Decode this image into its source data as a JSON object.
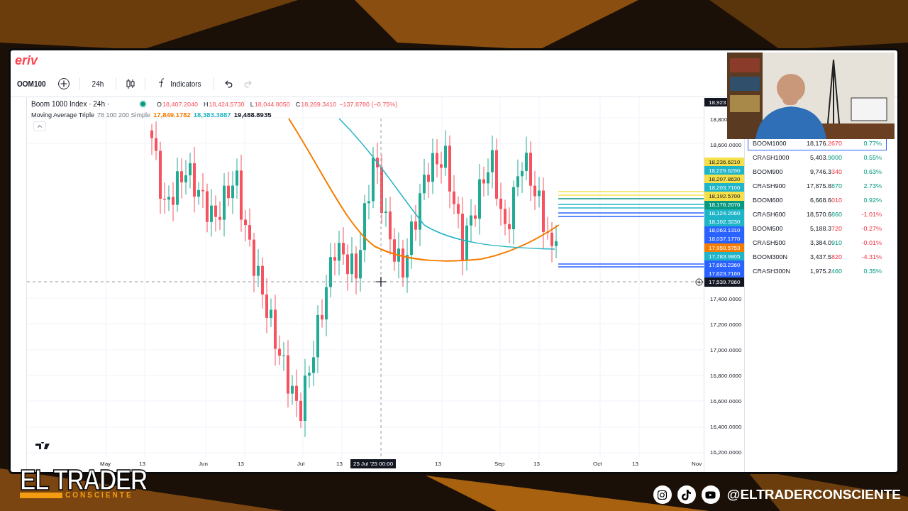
{
  "brand": {
    "logo": "eriv"
  },
  "toolbar": {
    "symbol": "OOM100",
    "interval": "24h",
    "indicators": "Indicators"
  },
  "legend": {
    "title": "Boom 1000 Index · 24h ·",
    "market_open": true,
    "ohlc": [
      {
        "label": "O",
        "value": "18,407.2040"
      },
      {
        "label": "H",
        "value": "18,424.5730"
      },
      {
        "label": "L",
        "value": "18,044.8050"
      },
      {
        "label": "C",
        "value": "18,269.3410"
      }
    ],
    "change": "−137.8780 (−0.75%)",
    "ma_name": "Moving Average Triple",
    "ma_params": "78 100 200 Simple",
    "ma_values": [
      {
        "value": "17,849.1782",
        "color": "#f57c00"
      },
      {
        "value": "18,383.3887",
        "color": "#26b5c6"
      },
      {
        "value": "19,488.8935",
        "color": "#131722"
      }
    ]
  },
  "price_axis": [
    {
      "kind": "tag",
      "text": "18,923",
      "color": "#131722"
    },
    {
      "kind": "tick",
      "text": "18,800"
    },
    {
      "kind": "tick",
      "text": "18,600.0000"
    },
    {
      "kind": "tag",
      "text": "18,236.6210",
      "color": "#f5e04a"
    },
    {
      "kind": "tag",
      "text": "18,229.6290",
      "color": "#1fb5c9"
    },
    {
      "kind": "tag",
      "text": "18,207.8630",
      "color": "#f5e04a"
    },
    {
      "kind": "tag",
      "text": "18,203.7100",
      "color": "#1fb5c9"
    },
    {
      "kind": "tag",
      "text": "18,192.5700",
      "color": "#f5e04a"
    },
    {
      "kind": "tag",
      "text": "18,176.2070",
      "color": "#089981"
    },
    {
      "kind": "tag",
      "text": "18,124.2060",
      "color": "#1fb5c9"
    },
    {
      "kind": "tag",
      "text": "18,102.3230",
      "color": "#1fb5c9"
    },
    {
      "kind": "tag",
      "text": "18,063.1310",
      "color": "#2962ff"
    },
    {
      "kind": "tag",
      "text": "18,037.1770",
      "color": "#2962ff"
    },
    {
      "kind": "tag",
      "text": "17,950.5753",
      "color": "#f57c00"
    },
    {
      "kind": "tag",
      "text": "17,783.9805",
      "color": "#1fb5c9"
    },
    {
      "kind": "tag",
      "text": "17,663.2360",
      "color": "#2962ff"
    },
    {
      "kind": "tag",
      "text": "17,623.7160",
      "color": "#2962ff"
    },
    {
      "kind": "tag",
      "text": "17,539.7860",
      "color": "#131722"
    },
    {
      "kind": "tick",
      "text": "17,400.0000"
    },
    {
      "kind": "tick",
      "text": "17,200.0000"
    },
    {
      "kind": "tick",
      "text": "17,000.0000"
    },
    {
      "kind": "tick",
      "text": "16,800.0000"
    },
    {
      "kind": "tick",
      "text": "16,600.0000"
    },
    {
      "kind": "tick",
      "text": "16,400.0000"
    },
    {
      "kind": "tick",
      "text": "16,200.0000"
    }
  ],
  "time_axis": [
    {
      "kind": "month",
      "text": "May"
    },
    {
      "kind": "day",
      "text": "13"
    },
    {
      "kind": "month",
      "text": "Jun"
    },
    {
      "kind": "day",
      "text": "13"
    },
    {
      "kind": "month",
      "text": "Jul"
    },
    {
      "kind": "day",
      "text": "13"
    },
    {
      "kind": "crosshair",
      "text": "25 Jul '25   00:00"
    },
    {
      "kind": "day",
      "text": "13"
    },
    {
      "kind": "month",
      "text": "Sep"
    },
    {
      "kind": "day",
      "text": "13"
    },
    {
      "kind": "month",
      "text": "Oct"
    },
    {
      "kind": "day",
      "text": "13"
    },
    {
      "kind": "month",
      "text": "Nov"
    }
  ],
  "watchlist": [
    {
      "symbol": "BOOM1000",
      "price": "18,176.",
      "price_tail": "2670",
      "tick_up": false,
      "change": "0.77%",
      "change_up": true,
      "selected": true
    },
    {
      "symbol": "CRASH1000",
      "price": "5,403.",
      "price_tail": "9000",
      "tick_up": true,
      "change": "0.55%",
      "change_up": true,
      "selected": false
    },
    {
      "symbol": "BOOM900",
      "price": "9,746.3",
      "price_tail": "340",
      "tick_up": false,
      "change": "0.63%",
      "change_up": true,
      "selected": false
    },
    {
      "symbol": "CRASH900",
      "price": "17,875.8",
      "price_tail": "870",
      "tick_up": true,
      "change": "2.73%",
      "change_up": true,
      "selected": false
    },
    {
      "symbol": "BOOM600",
      "price": "6,668.6",
      "price_tail": "010",
      "tick_up": false,
      "change": "0.92%",
      "change_up": true,
      "selected": false
    },
    {
      "symbol": "CRASH600",
      "price": "18,570.6",
      "price_tail": "860",
      "tick_up": true,
      "change": "-1.01%",
      "change_up": false,
      "selected": false
    },
    {
      "symbol": "BOOM500",
      "price": "5,188.3",
      "price_tail": "720",
      "tick_up": false,
      "change": "-0.27%",
      "change_up": false,
      "selected": false
    },
    {
      "symbol": "CRASH500",
      "price": "3,384.0",
      "price_tail": "910",
      "tick_up": true,
      "change": "-0.01%",
      "change_up": false,
      "selected": false
    },
    {
      "symbol": "BOOM300N",
      "price": "3,437.5",
      "price_tail": "820",
      "tick_up": false,
      "change": "-4.31%",
      "change_up": false,
      "selected": false
    },
    {
      "symbol": "CRASH300N",
      "price": "1,975.2",
      "price_tail": "460",
      "tick_up": true,
      "change": "0.35%",
      "change_up": true,
      "selected": false
    }
  ],
  "overlay": {
    "channel_name": "EL TRADER",
    "channel_tagline": "CONSCIENTE",
    "handle": "@ELTRADERCONSCIENTE"
  }
}
